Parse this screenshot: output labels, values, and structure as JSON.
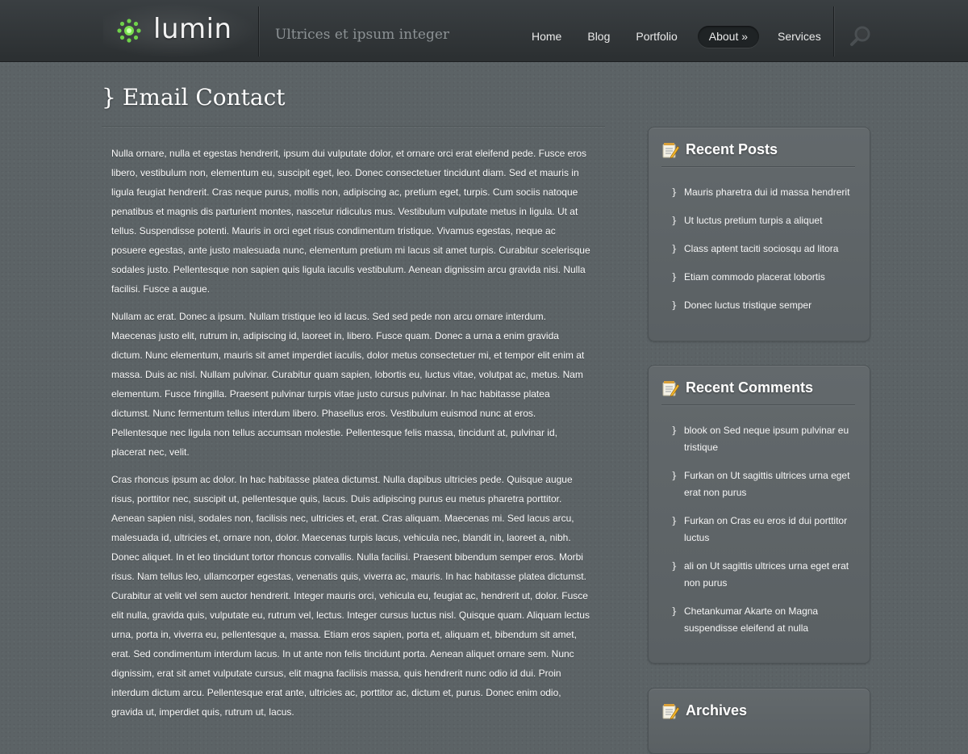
{
  "header": {
    "logo_text": "lumin",
    "tagline": "Ultrices et ipsum integer",
    "nav": [
      {
        "label": "Home"
      },
      {
        "label": "Blog"
      },
      {
        "label": "Portfolio"
      },
      {
        "label": "About »",
        "active": true
      },
      {
        "label": "Services"
      }
    ]
  },
  "page": {
    "title_brace": "}",
    "title": "Email Contact",
    "paragraphs": [
      "Nulla ornare, nulla et egestas hendrerit, ipsum dui vulputate dolor, et ornare orci erat eleifend pede. Fusce eros libero, vestibulum non, elementum eu, suscipit eget, leo. Donec consectetuer tincidunt diam. Sed et mauris in ligula feugiat hendrerit. Cras neque purus, mollis non, adipiscing ac, pretium eget, turpis. Cum sociis natoque penatibus et magnis dis parturient montes, nascetur ridiculus mus. Vestibulum vulputate metus in ligula. Ut at tellus. Suspendisse potenti. Mauris in orci eget risus condimentum tristique. Vivamus egestas, neque ac posuere egestas, ante justo malesuada nunc, elementum pretium mi lacus sit amet turpis. Curabitur scelerisque sodales justo. Pellentesque non sapien quis ligula iaculis vestibulum. Aenean dignissim arcu gravida nisi. Nulla facilisi. Fusce a augue.",
      "Nullam ac erat. Donec a ipsum. Nullam tristique leo id lacus. Sed sed pede non arcu ornare interdum. Maecenas justo elit, rutrum in, adipiscing id, laoreet in, libero. Fusce quam. Donec a urna a enim gravida dictum. Nunc elementum, mauris sit amet imperdiet iaculis, dolor metus consectetuer mi, et tempor elit enim at massa. Duis ac nisl. Nullam pulvinar. Curabitur quam sapien, lobortis eu, luctus vitae, volutpat ac, metus. Nam elementum. Fusce fringilla. Praesent pulvinar turpis vitae justo cursus pulvinar. In hac habitasse platea dictumst. Nunc fermentum tellus interdum libero. Phasellus eros. Vestibulum euismod nunc at eros. Pellentesque nec ligula non tellus accumsan molestie. Pellentesque felis massa, tincidunt at, pulvinar id, placerat nec, velit.",
      "Cras rhoncus ipsum ac dolor. In hac habitasse platea dictumst. Nulla dapibus ultricies pede. Quisque augue risus, porttitor nec, suscipit ut, pellentesque quis, lacus. Duis adipiscing purus eu metus pharetra porttitor. Aenean sapien nisi, sodales non, facilisis nec, ultricies et, erat. Cras aliquam. Maecenas mi. Sed lacus arcu, malesuada id, ultricies et, ornare non, dolor. Maecenas turpis lacus, vehicula nec, blandit in, laoreet a, nibh. Donec aliquet. In et leo tincidunt tortor rhoncus convallis. Nulla facilisi. Praesent bibendum semper eros. Morbi risus. Nam tellus leo, ullamcorper egestas, venenatis quis, viverra ac, mauris. In hac habitasse platea dictumst. Curabitur at velit vel sem auctor hendrerit. Integer mauris orci, vehicula eu, feugiat ac, hendrerit ut, dolor. Fusce elit nulla, gravida quis, vulputate eu, rutrum vel, lectus. Integer cursus luctus nisl. Quisque quam. Aliquam lectus urna, porta in, viverra eu, pellentesque a, massa. Etiam eros sapien, porta et, aliquam et, bibendum sit amet, erat. Sed condimentum interdum lacus. In ut ante non felis tincidunt porta. Aenean aliquet ornare sem. Nunc dignissim, erat sit amet vulputate cursus, elit magna facilisis massa, quis hendrerit nunc odio id dui. Proin interdum dictum arcu. Pellentesque erat ante, ultricies ac, porttitor ac, dictum et, purus. Donec enim odio, gravida ut, imperdiet quis, rutrum ut, lacus."
    ]
  },
  "sidebar": {
    "bullet": "}",
    "recent_posts": {
      "title": "Recent Posts",
      "items": [
        "Mauris pharetra dui id massa hendrerit",
        "Ut luctus pretium turpis a aliquet",
        "Class aptent taciti sociosqu ad litora",
        "Etiam commodo placerat lobortis",
        "Donec luctus tristique semper"
      ]
    },
    "recent_comments": {
      "title": "Recent Comments",
      "items": [
        "blook on Sed neque ipsum pulvinar eu tristique",
        "Furkan on Ut sagittis ultrices urna eget erat non purus",
        "Furkan on Cras eu eros id dui porttitor luctus",
        "ali on Ut sagittis ultrices urna eget erat non purus",
        "Chetankumar Akarte on Magna suspendisse eleifend at nulla"
      ]
    },
    "archives": {
      "title": "Archives"
    }
  },
  "colors": {
    "background": "#5c6366",
    "header": "#2e3234",
    "logo_accent": "#6fd24a",
    "tagline": "#8c9295"
  },
  "icons": {
    "logo": "lumin-dot-cluster-icon",
    "search": "search-icon",
    "widget": "notepad-pencil-icon"
  }
}
